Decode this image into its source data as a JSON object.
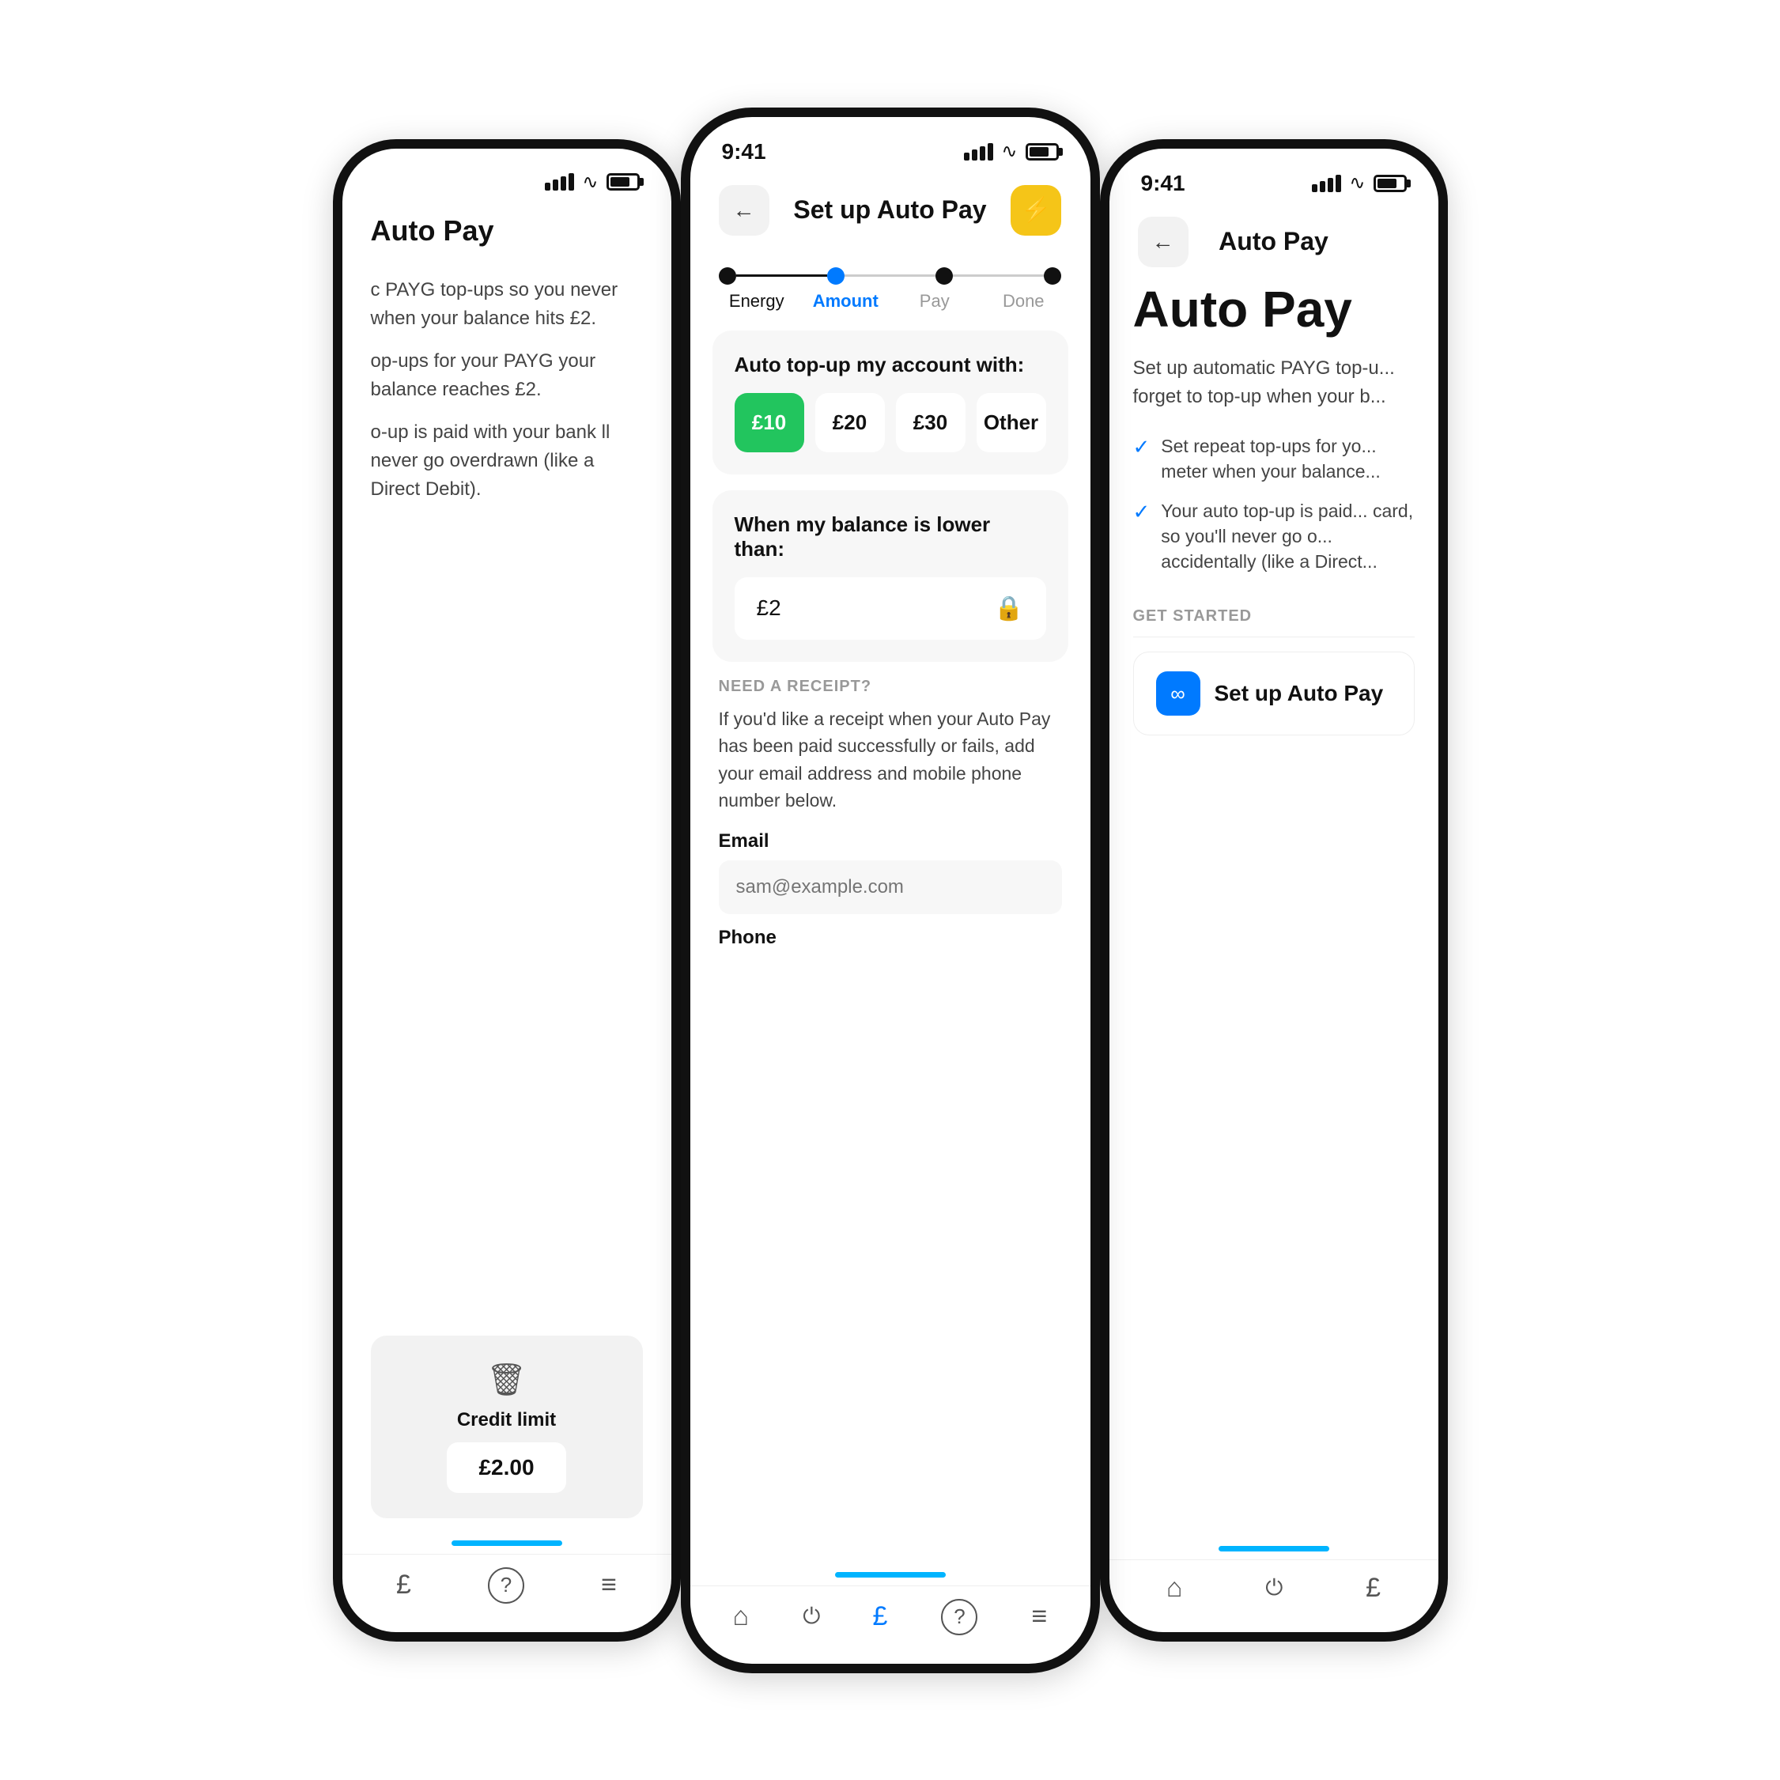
{
  "scene": {
    "bg": "#ffffff"
  },
  "phone_left": {
    "header": {
      "title": "Auto Pay"
    },
    "body": {
      "desc1": "c PAYG top-ups so you never when your balance hits £2.",
      "desc2": "op-ups for your PAYG your balance reaches £2.",
      "desc3": "o-up is paid with your bank ll never go overdrawn (like a Direct Debit)."
    },
    "credit_card": {
      "credit_label": "Credit limit",
      "credit_value": "£2.00"
    },
    "bottom_nav": {
      "items": [
        "£",
        "?",
        "≡"
      ]
    }
  },
  "phone_center": {
    "status_bar": {
      "time": "9:41"
    },
    "top_nav": {
      "back_label": "←",
      "title": "Set up Auto Pay"
    },
    "stepper": {
      "steps": [
        "Energy",
        "Amount",
        "Pay",
        "Done"
      ],
      "active_index": 1
    },
    "amount_section": {
      "title": "Auto top-up my account with:",
      "options": [
        "£10",
        "£20",
        "£30",
        "Other"
      ],
      "selected": 0
    },
    "balance_section": {
      "title": "When my balance is lower than:",
      "value": "£2"
    },
    "receipt_section": {
      "label": "NEED A RECEIPT?",
      "description": "If you'd like a receipt when your Auto Pay has been paid successfully or fails, add your email address and mobile phone number below.",
      "email_label": "Email",
      "email_placeholder": "sam@example.com",
      "phone_label": "Phone"
    },
    "bottom_nav": {
      "items": [
        "🏠",
        "⚡",
        "£",
        "?",
        "≡"
      ]
    }
  },
  "phone_right": {
    "status_bar": {
      "time": "9:41"
    },
    "top_nav": {
      "back_label": "←",
      "title": "Auto Pay"
    },
    "body": {
      "title": "Auto Pay",
      "description": "Set up automatic PAYG top-u... forget to top-up when your b...",
      "check1": "Set repeat top-ups for yo... meter when your balance...",
      "check2": "Your auto top-up is paid... card, so you'll never go o... accidentally (like a Direct...",
      "get_started_label": "GET STARTED",
      "setup_btn_text": "Set up Auto Pay"
    },
    "bottom_nav": {
      "items": [
        "🏠",
        "⚡",
        "£"
      ]
    }
  }
}
